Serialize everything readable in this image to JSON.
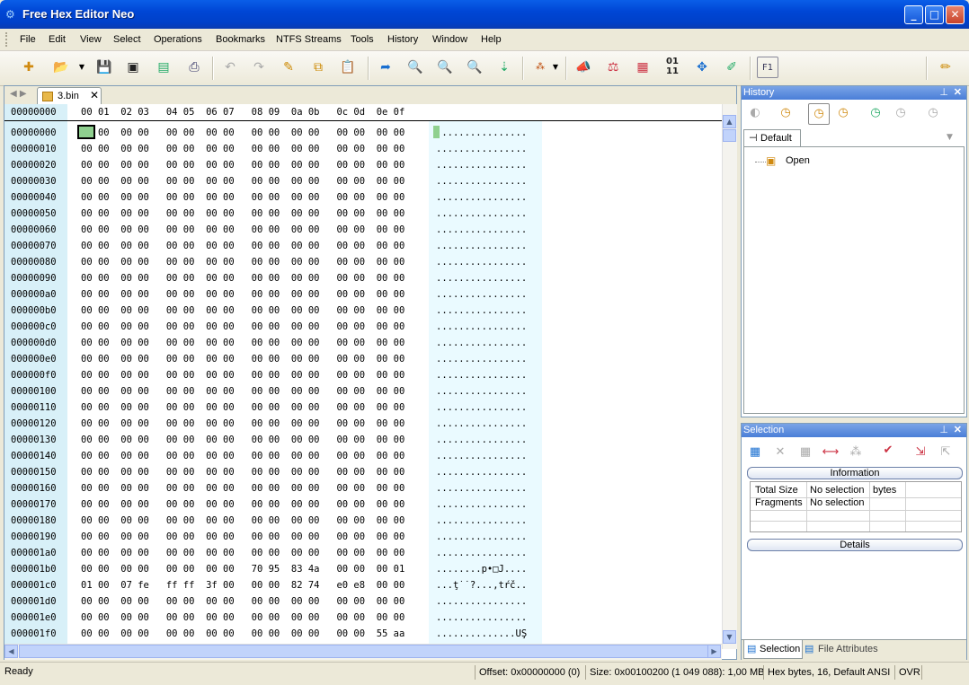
{
  "window": {
    "title": "Free Hex Editor Neo"
  },
  "menu": [
    "File",
    "Edit",
    "View",
    "Select",
    "Operations",
    "Bookmarks",
    "NTFS Streams",
    "Tools",
    "History",
    "Window",
    "Help"
  ],
  "tab": {
    "label": "3.bin"
  },
  "hex_header": {
    "offset": "00000000",
    "columns": "00 01  02 03   04 05  06 07   08 09  0a 0b   0c 0d  0e 0f"
  },
  "rows": [
    {
      "off": "00000000",
      "hex": "00 00  00 00   00 00  00 00   00 00  00 00   00 00  00 00",
      "chars": "................"
    },
    {
      "off": "00000010",
      "hex": "00 00  00 00   00 00  00 00   00 00  00 00   00 00  00 00",
      "chars": "................"
    },
    {
      "off": "00000020",
      "hex": "00 00  00 00   00 00  00 00   00 00  00 00   00 00  00 00",
      "chars": "................"
    },
    {
      "off": "00000030",
      "hex": "00 00  00 00   00 00  00 00   00 00  00 00   00 00  00 00",
      "chars": "................"
    },
    {
      "off": "00000040",
      "hex": "00 00  00 00   00 00  00 00   00 00  00 00   00 00  00 00",
      "chars": "................"
    },
    {
      "off": "00000050",
      "hex": "00 00  00 00   00 00  00 00   00 00  00 00   00 00  00 00",
      "chars": "................"
    },
    {
      "off": "00000060",
      "hex": "00 00  00 00   00 00  00 00   00 00  00 00   00 00  00 00",
      "chars": "................"
    },
    {
      "off": "00000070",
      "hex": "00 00  00 00   00 00  00 00   00 00  00 00   00 00  00 00",
      "chars": "................"
    },
    {
      "off": "00000080",
      "hex": "00 00  00 00   00 00  00 00   00 00  00 00   00 00  00 00",
      "chars": "................"
    },
    {
      "off": "00000090",
      "hex": "00 00  00 00   00 00  00 00   00 00  00 00   00 00  00 00",
      "chars": "................"
    },
    {
      "off": "000000a0",
      "hex": "00 00  00 00   00 00  00 00   00 00  00 00   00 00  00 00",
      "chars": "................"
    },
    {
      "off": "000000b0",
      "hex": "00 00  00 00   00 00  00 00   00 00  00 00   00 00  00 00",
      "chars": "................"
    },
    {
      "off": "000000c0",
      "hex": "00 00  00 00   00 00  00 00   00 00  00 00   00 00  00 00",
      "chars": "................"
    },
    {
      "off": "000000d0",
      "hex": "00 00  00 00   00 00  00 00   00 00  00 00   00 00  00 00",
      "chars": "................"
    },
    {
      "off": "000000e0",
      "hex": "00 00  00 00   00 00  00 00   00 00  00 00   00 00  00 00",
      "chars": "................"
    },
    {
      "off": "000000f0",
      "hex": "00 00  00 00   00 00  00 00   00 00  00 00   00 00  00 00",
      "chars": "................"
    },
    {
      "off": "00000100",
      "hex": "00 00  00 00   00 00  00 00   00 00  00 00   00 00  00 00",
      "chars": "................"
    },
    {
      "off": "00000110",
      "hex": "00 00  00 00   00 00  00 00   00 00  00 00   00 00  00 00",
      "chars": "................"
    },
    {
      "off": "00000120",
      "hex": "00 00  00 00   00 00  00 00   00 00  00 00   00 00  00 00",
      "chars": "................"
    },
    {
      "off": "00000130",
      "hex": "00 00  00 00   00 00  00 00   00 00  00 00   00 00  00 00",
      "chars": "................"
    },
    {
      "off": "00000140",
      "hex": "00 00  00 00   00 00  00 00   00 00  00 00   00 00  00 00",
      "chars": "................"
    },
    {
      "off": "00000150",
      "hex": "00 00  00 00   00 00  00 00   00 00  00 00   00 00  00 00",
      "chars": "................"
    },
    {
      "off": "00000160",
      "hex": "00 00  00 00   00 00  00 00   00 00  00 00   00 00  00 00",
      "chars": "................"
    },
    {
      "off": "00000170",
      "hex": "00 00  00 00   00 00  00 00   00 00  00 00   00 00  00 00",
      "chars": "................"
    },
    {
      "off": "00000180",
      "hex": "00 00  00 00   00 00  00 00   00 00  00 00   00 00  00 00",
      "chars": "................"
    },
    {
      "off": "00000190",
      "hex": "00 00  00 00   00 00  00 00   00 00  00 00   00 00  00 00",
      "chars": "................"
    },
    {
      "off": "000001a0",
      "hex": "00 00  00 00   00 00  00 00   00 00  00 00   00 00  00 00",
      "chars": "................"
    },
    {
      "off": "000001b0",
      "hex": "00 00  00 00   00 00  00 00   70 95  83 4a   00 00  00 01",
      "chars": "........p•□J...."
    },
    {
      "off": "000001c0",
      "hex": "01 00  07 fe   ff ff  3f 00   00 00  82 74   e0 e8  00 00",
      "chars": "...ţ˙˙?...‚tŕč.."
    },
    {
      "off": "000001d0",
      "hex": "00 00  00 00   00 00  00 00   00 00  00 00   00 00  00 00",
      "chars": "................"
    },
    {
      "off": "000001e0",
      "hex": "00 00  00 00   00 00  00 00   00 00  00 00   00 00  00 00",
      "chars": "................"
    },
    {
      "off": "000001f0",
      "hex": "00 00  00 00   00 00  00 00   00 00  00 00   00 00  55 aa",
      "chars": "..............UŞ"
    }
  ],
  "history_panel": {
    "title": "History",
    "tab": "Default",
    "item": "Open"
  },
  "selection_panel": {
    "title": "Selection",
    "information_label": "Information",
    "details_label": "Details",
    "total_size_label": "Total Size",
    "total_size_value": "No selection",
    "total_size_unit": "bytes",
    "fragments_label": "Fragments",
    "fragments_value": "No selection",
    "tabs": [
      "Selection",
      "File Attributes"
    ]
  },
  "status": {
    "ready": "Ready",
    "offset": "Offset: 0x00000000 (0)",
    "size": "Size: 0x00100200 (1 049 088): 1,00 MB",
    "mode": "Hex bytes, 16, Default ANSI",
    "ovr": "OVR"
  }
}
